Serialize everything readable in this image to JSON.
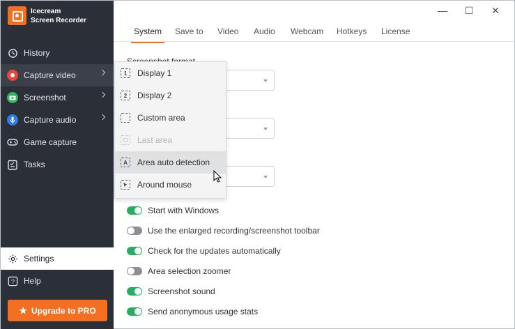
{
  "app": {
    "brand_line1": "Icecream",
    "brand_line2": "Screen Recorder",
    "accent": "#f36f21"
  },
  "sidebar": {
    "items": [
      {
        "label": "History",
        "icon": "history-icon"
      },
      {
        "label": "Capture video",
        "icon": "record-icon"
      },
      {
        "label": "Screenshot",
        "icon": "camera-icon"
      },
      {
        "label": "Capture audio",
        "icon": "microphone-icon"
      },
      {
        "label": "Game capture",
        "icon": "gamepad-icon"
      },
      {
        "label": "Tasks",
        "icon": "tasks-icon"
      }
    ],
    "settings_label": "Settings",
    "help_label": "Help",
    "upgrade_label": "Upgrade to PRO"
  },
  "tabs": [
    "System",
    "Save to",
    "Video",
    "Audio",
    "Webcam",
    "Hotkeys",
    "License"
  ],
  "active_tab": "System",
  "content": {
    "screenshot_format_label": "Screenshot format"
  },
  "capture_menu": [
    {
      "label": "Display 1",
      "icon_glyph": "1",
      "disabled": false
    },
    {
      "label": "Display 2",
      "icon_glyph": "2",
      "disabled": false
    },
    {
      "label": "Custom area",
      "icon_glyph": "",
      "disabled": false
    },
    {
      "label": "Last area",
      "icon_glyph": "",
      "disabled": true
    },
    {
      "label": "Area auto detection",
      "icon_glyph": "A",
      "disabled": false
    },
    {
      "label": "Around mouse",
      "icon_glyph": "",
      "disabled": false
    }
  ],
  "toggles": [
    {
      "label": "Start with Windows",
      "on": true
    },
    {
      "label": "Use the enlarged recording/screenshot toolbar",
      "on": false
    },
    {
      "label": "Check for the updates automatically",
      "on": true
    },
    {
      "label": "Area selection zoomer",
      "on": false
    },
    {
      "label": "Screenshot sound",
      "on": true
    },
    {
      "label": "Send anonymous usage stats",
      "on": true
    }
  ]
}
